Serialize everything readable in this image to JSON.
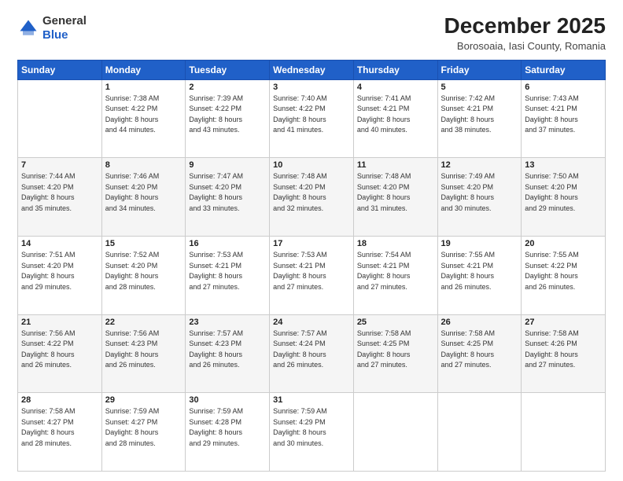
{
  "header": {
    "logo_line1": "General",
    "logo_line2": "Blue",
    "title": "December 2025",
    "subtitle": "Borosoaia, Iasi County, Romania"
  },
  "days_of_week": [
    "Sunday",
    "Monday",
    "Tuesday",
    "Wednesday",
    "Thursday",
    "Friday",
    "Saturday"
  ],
  "weeks": [
    [
      {
        "day": "",
        "info": ""
      },
      {
        "day": "1",
        "info": "Sunrise: 7:38 AM\nSunset: 4:22 PM\nDaylight: 8 hours\nand 44 minutes."
      },
      {
        "day": "2",
        "info": "Sunrise: 7:39 AM\nSunset: 4:22 PM\nDaylight: 8 hours\nand 43 minutes."
      },
      {
        "day": "3",
        "info": "Sunrise: 7:40 AM\nSunset: 4:22 PM\nDaylight: 8 hours\nand 41 minutes."
      },
      {
        "day": "4",
        "info": "Sunrise: 7:41 AM\nSunset: 4:21 PM\nDaylight: 8 hours\nand 40 minutes."
      },
      {
        "day": "5",
        "info": "Sunrise: 7:42 AM\nSunset: 4:21 PM\nDaylight: 8 hours\nand 38 minutes."
      },
      {
        "day": "6",
        "info": "Sunrise: 7:43 AM\nSunset: 4:21 PM\nDaylight: 8 hours\nand 37 minutes."
      }
    ],
    [
      {
        "day": "7",
        "info": "Sunrise: 7:44 AM\nSunset: 4:20 PM\nDaylight: 8 hours\nand 35 minutes."
      },
      {
        "day": "8",
        "info": "Sunrise: 7:46 AM\nSunset: 4:20 PM\nDaylight: 8 hours\nand 34 minutes."
      },
      {
        "day": "9",
        "info": "Sunrise: 7:47 AM\nSunset: 4:20 PM\nDaylight: 8 hours\nand 33 minutes."
      },
      {
        "day": "10",
        "info": "Sunrise: 7:48 AM\nSunset: 4:20 PM\nDaylight: 8 hours\nand 32 minutes."
      },
      {
        "day": "11",
        "info": "Sunrise: 7:48 AM\nSunset: 4:20 PM\nDaylight: 8 hours\nand 31 minutes."
      },
      {
        "day": "12",
        "info": "Sunrise: 7:49 AM\nSunset: 4:20 PM\nDaylight: 8 hours\nand 30 minutes."
      },
      {
        "day": "13",
        "info": "Sunrise: 7:50 AM\nSunset: 4:20 PM\nDaylight: 8 hours\nand 29 minutes."
      }
    ],
    [
      {
        "day": "14",
        "info": "Sunrise: 7:51 AM\nSunset: 4:20 PM\nDaylight: 8 hours\nand 29 minutes."
      },
      {
        "day": "15",
        "info": "Sunrise: 7:52 AM\nSunset: 4:20 PM\nDaylight: 8 hours\nand 28 minutes."
      },
      {
        "day": "16",
        "info": "Sunrise: 7:53 AM\nSunset: 4:21 PM\nDaylight: 8 hours\nand 27 minutes."
      },
      {
        "day": "17",
        "info": "Sunrise: 7:53 AM\nSunset: 4:21 PM\nDaylight: 8 hours\nand 27 minutes."
      },
      {
        "day": "18",
        "info": "Sunrise: 7:54 AM\nSunset: 4:21 PM\nDaylight: 8 hours\nand 27 minutes."
      },
      {
        "day": "19",
        "info": "Sunrise: 7:55 AM\nSunset: 4:21 PM\nDaylight: 8 hours\nand 26 minutes."
      },
      {
        "day": "20",
        "info": "Sunrise: 7:55 AM\nSunset: 4:22 PM\nDaylight: 8 hours\nand 26 minutes."
      }
    ],
    [
      {
        "day": "21",
        "info": "Sunrise: 7:56 AM\nSunset: 4:22 PM\nDaylight: 8 hours\nand 26 minutes."
      },
      {
        "day": "22",
        "info": "Sunrise: 7:56 AM\nSunset: 4:23 PM\nDaylight: 8 hours\nand 26 minutes."
      },
      {
        "day": "23",
        "info": "Sunrise: 7:57 AM\nSunset: 4:23 PM\nDaylight: 8 hours\nand 26 minutes."
      },
      {
        "day": "24",
        "info": "Sunrise: 7:57 AM\nSunset: 4:24 PM\nDaylight: 8 hours\nand 26 minutes."
      },
      {
        "day": "25",
        "info": "Sunrise: 7:58 AM\nSunset: 4:25 PM\nDaylight: 8 hours\nand 27 minutes."
      },
      {
        "day": "26",
        "info": "Sunrise: 7:58 AM\nSunset: 4:25 PM\nDaylight: 8 hours\nand 27 minutes."
      },
      {
        "day": "27",
        "info": "Sunrise: 7:58 AM\nSunset: 4:26 PM\nDaylight: 8 hours\nand 27 minutes."
      }
    ],
    [
      {
        "day": "28",
        "info": "Sunrise: 7:58 AM\nSunset: 4:27 PM\nDaylight: 8 hours\nand 28 minutes."
      },
      {
        "day": "29",
        "info": "Sunrise: 7:59 AM\nSunset: 4:27 PM\nDaylight: 8 hours\nand 28 minutes."
      },
      {
        "day": "30",
        "info": "Sunrise: 7:59 AM\nSunset: 4:28 PM\nDaylight: 8 hours\nand 29 minutes."
      },
      {
        "day": "31",
        "info": "Sunrise: 7:59 AM\nSunset: 4:29 PM\nDaylight: 8 hours\nand 30 minutes."
      },
      {
        "day": "",
        "info": ""
      },
      {
        "day": "",
        "info": ""
      },
      {
        "day": "",
        "info": ""
      }
    ]
  ]
}
